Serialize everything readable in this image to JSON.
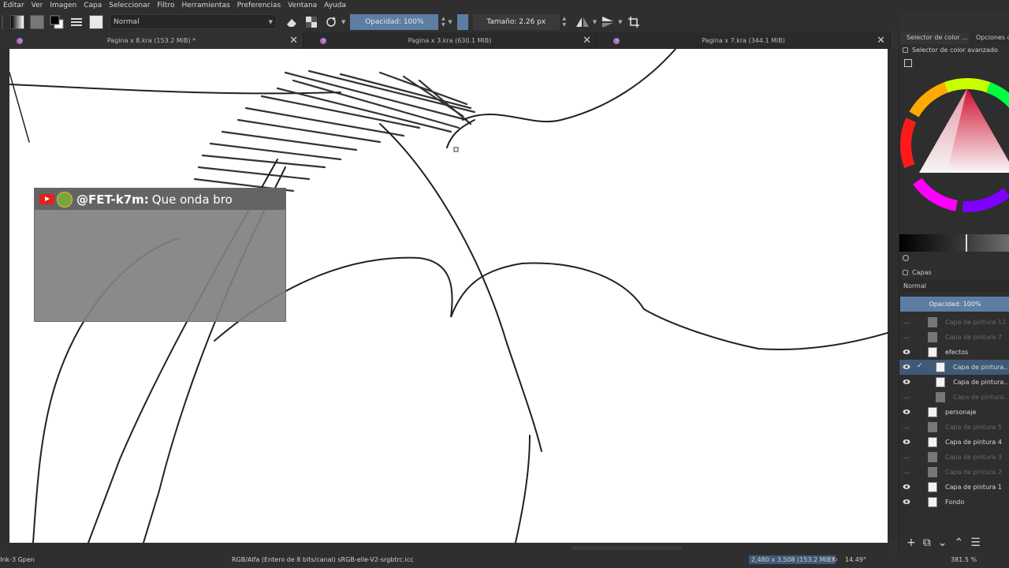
{
  "menubar": {
    "items": [
      "Editar",
      "Ver",
      "Imagen",
      "Capa",
      "Seleccionar",
      "Filtro",
      "Herramientas",
      "Preferencias",
      "Ventana",
      "Ayuda"
    ]
  },
  "toolbar": {
    "blend_mode": "Normal",
    "opacity_label": "Opacidad: 100%",
    "size_label": "Tamaño: 2.26 px"
  },
  "tabs": [
    {
      "label": "Pagina x 8.kra (153.2 MiB) *",
      "close": "✕"
    },
    {
      "label": "Pagina x 3.kra (630.1 MiB)",
      "close": "✕"
    },
    {
      "label": "Pagina x 7.kra (344.1 MiB)",
      "close": "✕"
    }
  ],
  "chat": {
    "user": "@FET-k7m:",
    "message": "Que onda bro"
  },
  "dock": {
    "tab1": "Selector de color ...",
    "tab2": "Opciones de",
    "color_selector_title": "Selector de color avanzado",
    "layers_title": "Capas",
    "layers_blend": "Normal",
    "layers_opacity": "Opacidad:  100%",
    "layers": [
      {
        "name": "Capa de pintura 12",
        "visible": false,
        "selected": false,
        "indent": 0
      },
      {
        "name": "Capa de pintura 7",
        "visible": false,
        "selected": false,
        "indent": 0
      },
      {
        "name": "efectos",
        "visible": true,
        "selected": false,
        "indent": 0
      },
      {
        "name": "Capa de pintura...",
        "visible": true,
        "selected": true,
        "indent": 1
      },
      {
        "name": "Capa de pintura...",
        "visible": true,
        "selected": false,
        "indent": 1
      },
      {
        "name": "Capa de pintura...",
        "visible": false,
        "selected": false,
        "indent": 1
      },
      {
        "name": "personaje",
        "visible": true,
        "selected": false,
        "indent": 0
      },
      {
        "name": "Capa de pintura 5",
        "visible": false,
        "selected": false,
        "indent": 0
      },
      {
        "name": "Capa de pintura 4",
        "visible": true,
        "selected": false,
        "indent": 0
      },
      {
        "name": "Capa de pintura 3",
        "visible": false,
        "selected": false,
        "indent": 0
      },
      {
        "name": "Capa de pintura 2",
        "visible": false,
        "selected": false,
        "indent": 0
      },
      {
        "name": "Capa de pintura 1",
        "visible": true,
        "selected": false,
        "indent": 0
      },
      {
        "name": "Fondo",
        "visible": true,
        "selected": false,
        "indent": 0
      }
    ]
  },
  "status": {
    "brush": "Ink-3 Gpen",
    "color_info": "RGB/Alfa (Entero de 8 bits/canal)  sRGB-elle-V2-srgbtrc.icc",
    "dimensions": "2,480 x 3,508 (153.2 MiB)",
    "rotation": "14.49°",
    "zoom": "381.5 %"
  }
}
